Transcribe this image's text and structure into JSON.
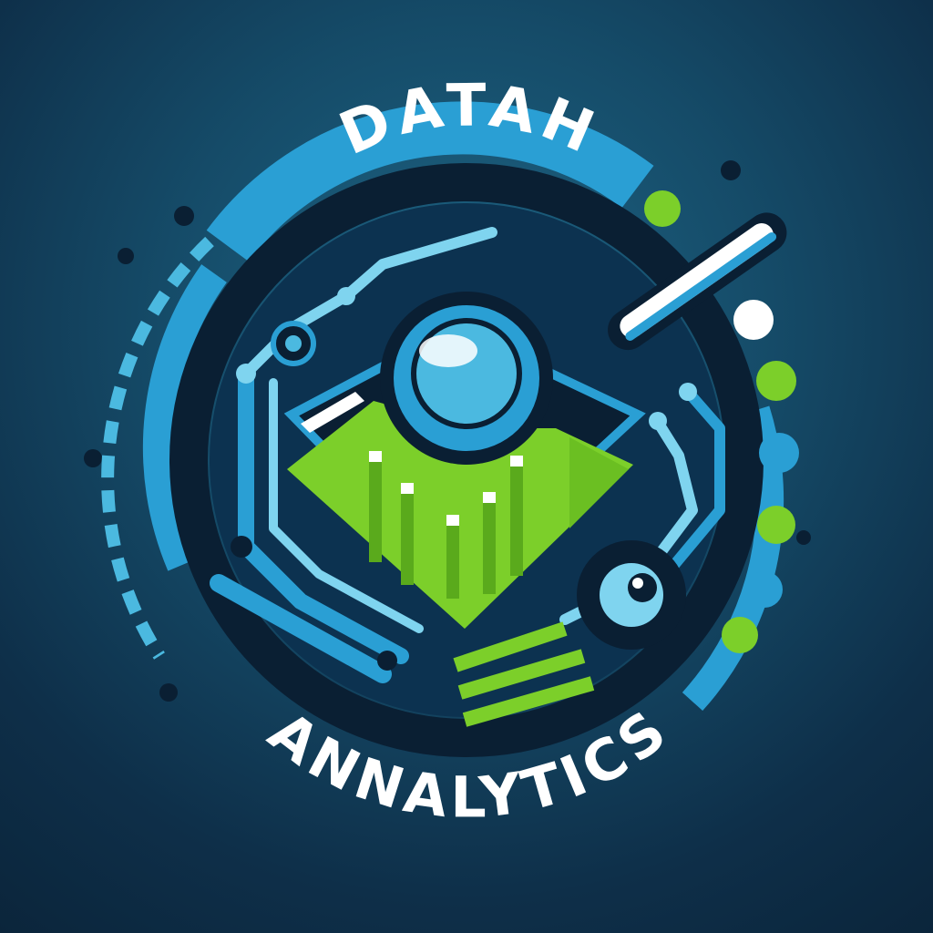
{
  "logo": {
    "top_text": "DATAH",
    "bottom_text": "ANNALYTICS"
  },
  "colors": {
    "background": "#154b68",
    "ring_blue": "#2a9fd4",
    "light_blue": "#7fd4ef",
    "lime": "#7ccf2a",
    "dark": "#0a1f33",
    "text": "#ffffff"
  },
  "icons": [
    "magnifier-icon",
    "bar-chart-icon",
    "circuit-trace-icon"
  ]
}
